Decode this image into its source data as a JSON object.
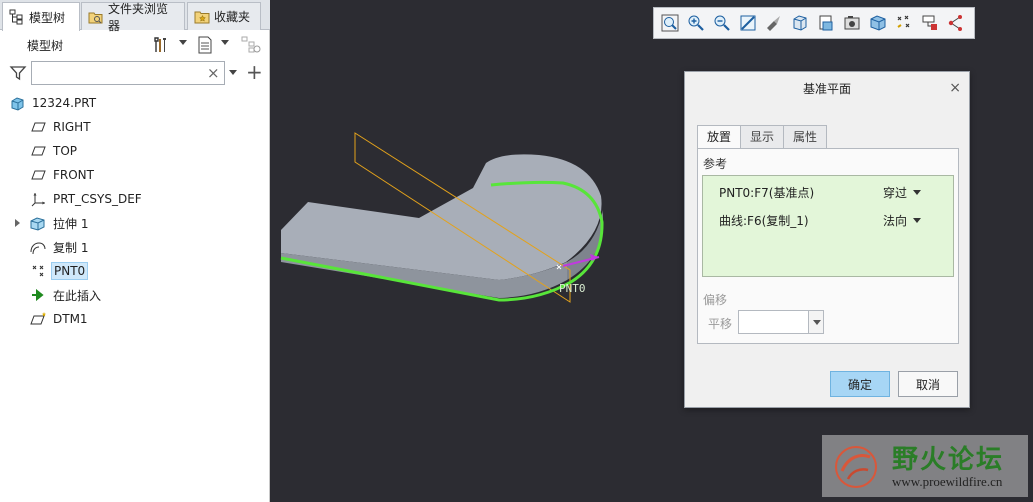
{
  "panel_tabs": [
    {
      "label": "模型树",
      "active": true
    },
    {
      "label": "文件夹浏览器",
      "active": false
    },
    {
      "label": "收藏夹",
      "active": false
    }
  ],
  "tree_header": {
    "title": "模型树"
  },
  "search": {
    "value": "",
    "placeholder": "",
    "clear_glyph": "×"
  },
  "add_glyph": "+",
  "tree": {
    "items": [
      {
        "label": "12324.PRT",
        "icon": "part-icon",
        "selected": false
      },
      {
        "label": "RIGHT",
        "icon": "datum-plane-icon",
        "selected": false
      },
      {
        "label": "TOP",
        "icon": "datum-plane-icon",
        "selected": false
      },
      {
        "label": "FRONT",
        "icon": "datum-plane-icon",
        "selected": false
      },
      {
        "label": "PRT_CSYS_DEF",
        "icon": "csys-icon",
        "selected": false
      },
      {
        "label": "拉伸 1",
        "icon": "extrude-icon",
        "selected": false,
        "expandable": true
      },
      {
        "label": "复制 1",
        "icon": "copy-icon",
        "selected": false
      },
      {
        "label": "PNT0",
        "icon": "datum-point-icon",
        "selected": true
      },
      {
        "label": "在此插入",
        "icon": "insert-arrow-icon",
        "selected": false
      },
      {
        "label": "DTM1",
        "icon": "new-datum-plane-icon",
        "selected": false
      }
    ]
  },
  "viewport": {
    "point_label": "PNT0",
    "colors": {
      "background": "#2c2c32",
      "model": "#a7adb6",
      "edge": "#58e53a",
      "plane": "#e3a21b",
      "arrow": "#c03adf"
    }
  },
  "toolbar": {
    "buttons": [
      "zoom-fit-icon",
      "zoom-in-icon",
      "zoom-out-icon",
      "repaint-icon",
      "orient-icon",
      "display-style-icon",
      "saved-views-icon",
      "view-manager-icon",
      "perspective-icon",
      "datum-display-icon",
      "annotation-display-icon",
      "spin-center-icon"
    ]
  },
  "dialog": {
    "title": "基准平面",
    "close_glyph": "×",
    "tabs": [
      {
        "label": "放置",
        "active": true
      },
      {
        "label": "显示",
        "active": false
      },
      {
        "label": "属性",
        "active": false
      }
    ],
    "references_label": "参考",
    "references": [
      {
        "name": "PNT0:F7(基准点)",
        "type": "穿过"
      },
      {
        "name": "曲线:F6(复制_1)",
        "type": "法向"
      }
    ],
    "offset_label": "偏移",
    "translate_label": "平移",
    "translate_value": "",
    "ok_label": "确定",
    "cancel_label": "取消"
  },
  "watermark": {
    "title": "野火论坛",
    "url": "www.proewildfire.cn"
  }
}
